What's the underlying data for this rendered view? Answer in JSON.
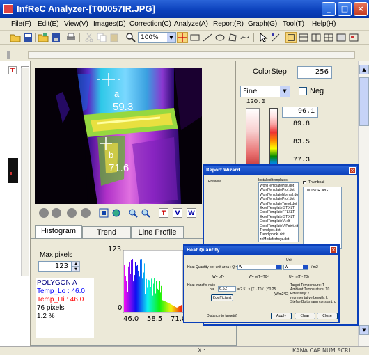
{
  "window": {
    "title": "InfReC Analyzer-[T00057IR.JPG]",
    "controls": [
      "_",
      "□",
      "×"
    ]
  },
  "menu": [
    "File(F)",
    "Edit(E)",
    "View(V)",
    "Images(D)",
    "Correction(C)",
    "Analyze(A)",
    "Report(R)",
    "Graph(G)",
    "Tool(T)",
    "Help(H)"
  ],
  "toolbar": {
    "zoom": "100%"
  },
  "left_strip": {
    "icons": [
      "T",
      "V"
    ]
  },
  "image": {
    "points": [
      {
        "label": "a",
        "value": "59.3"
      },
      {
        "label": "b",
        "value": "71.6"
      }
    ]
  },
  "image_tools": [
    "T",
    "V",
    "W"
  ],
  "right_panel": {
    "colorstep_label": "ColorStep",
    "colorstep_value": "256",
    "palette": "Fine",
    "neg_label": "Neg",
    "scale_top": "120.0",
    "scale_input": "96.1",
    "scale_values": [
      "89.8",
      "83.5",
      "77.3"
    ]
  },
  "tabs": [
    "Histogram",
    "Trend",
    "Line Profile"
  ],
  "histogram": {
    "max_pixels_label": "Max pixels",
    "max_pixels_value": "123",
    "polygon": "POLYGON A",
    "temp_lo": "Temp_Lo : 46.0",
    "temp_hi": "Temp_Hi : 46.0",
    "pixels": "76 pixels",
    "percent": "1.2 %",
    "y_max": "123",
    "y_min": "0",
    "x_ticks": [
      "46.0",
      "58.5",
      "71.0"
    ]
  },
  "report_wizard": {
    "title": "Report Wizard",
    "preview_label": "Preview",
    "templates_label": "Installed templates:",
    "templates": [
      "WordTemplateHist.dot",
      "WordTemplateProf.dot",
      "WordTemplateNormal.dot",
      "WordTemplateProf.dot",
      "WordTemplateTrend.dot",
      "ExcelTemplateIST.XLT",
      "ExcelTemplateFFLXLT",
      "ExcelTemplateIST.XLT",
      "ExcelTemplateVr.xlt",
      "ExcelTemplateVrPoint.xlt",
      "Trend.pot.dot",
      "Trend.poinkl.dot",
      "zeMedaferhcyz.dot"
    ],
    "thumbnail_label": "Thumbnail",
    "thumbnail_item": "T00057IR.JPG"
  },
  "heat_quantity": {
    "title": "Heat Quantity",
    "unit_label": "Unit",
    "per_unit_label": "Heat Quantity per unit area : Q =",
    "q_unit": "W",
    "per_m2": "/ m2",
    "formula1": "W= σT⁴",
    "formula2": "W= σ(T⁴-T0⁴)",
    "formula3": "U= h·(T - T0)",
    "transfer_label": "Heat transfer ratio",
    "h_label": "h =",
    "h_value": "6.52",
    "coefficient_btn": "Coefficient",
    "expr": "= 2.51 × (T - T0 / L)^0.25",
    "unit_wm2": "[W/m2°C]",
    "notes": [
      "Target Temperature: T",
      "Ambient Temperature: T0",
      "Emissivity: ε",
      "representative Length: L",
      "Stefan-Boltzmann constant: σ"
    ],
    "distance_label": "Distance to target(i)",
    "buttons": [
      "Apply",
      "Clear",
      "Close"
    ]
  },
  "statusbar": {
    "coords": "X :",
    "indicators": "KANA  CAP  NUM  SCRL"
  }
}
